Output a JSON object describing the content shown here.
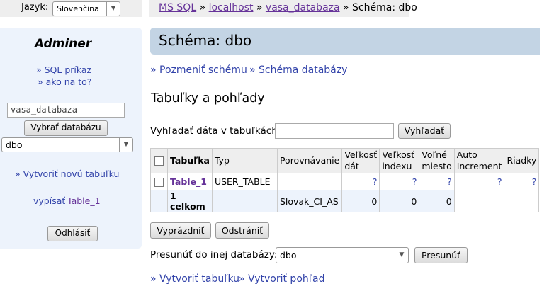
{
  "language": {
    "label": "Jazyk:",
    "selected": "Slovenčina"
  },
  "sidebar": {
    "logo": "Adminer",
    "sql_link": "» SQL príkaz",
    "howto_link": "» ako na to?",
    "db_input_placeholder": "vasa_databaza",
    "select_db_button": "Vybrať databázu",
    "db_select_value": "dbo",
    "create_table_link": "» Vytvoriť novú tabuľku",
    "list_link": "vypísať",
    "table_link": "Table_1",
    "logout_button": "Odhlásiť"
  },
  "breadcrumb": {
    "server_type": "MS SQL",
    "sep1": " » ",
    "server": "localhost",
    "sep2": " » ",
    "database": "vasa_databaza",
    "current": " » Schéma: dbo"
  },
  "page_title": "Schéma: dbo",
  "actions": {
    "alter_schema": "» Pozmeniť schému",
    "db_schema": "» Schéma databázy"
  },
  "section_title": "Tabuľky a pohľady",
  "search": {
    "label": "Vyhľadať dáta v tabuľkách:",
    "value": "",
    "button": "Vyhľadať"
  },
  "table": {
    "headers": [
      "Tabuľka",
      "Typ",
      "Porovnávanie",
      "Veľkosť dát",
      "Veľkosť indexu",
      "Voľné miesto",
      "Auto Increment",
      "Riadky"
    ],
    "rows": [
      {
        "name": "Table_1",
        "type": "USER_TABLE",
        "collation": "",
        "data_size": "?",
        "index_size": "?",
        "free": "?",
        "auto_inc": "?",
        "rows": "?"
      }
    ],
    "total": {
      "label": "1 celkom",
      "collation": "Slovak_CI_AS",
      "data_size": "0",
      "index_size": "0",
      "free": "0"
    }
  },
  "buttons": {
    "truncate": "Vyprázdniť",
    "drop": "Odstrániť"
  },
  "move": {
    "label": "Presunúť do inej databázy:",
    "selected": "dbo",
    "button": "Presunúť"
  },
  "bottom": {
    "create_table": "» Vytvoriť tabuľku",
    "create_view": "» Vytvoriť pohľad"
  }
}
